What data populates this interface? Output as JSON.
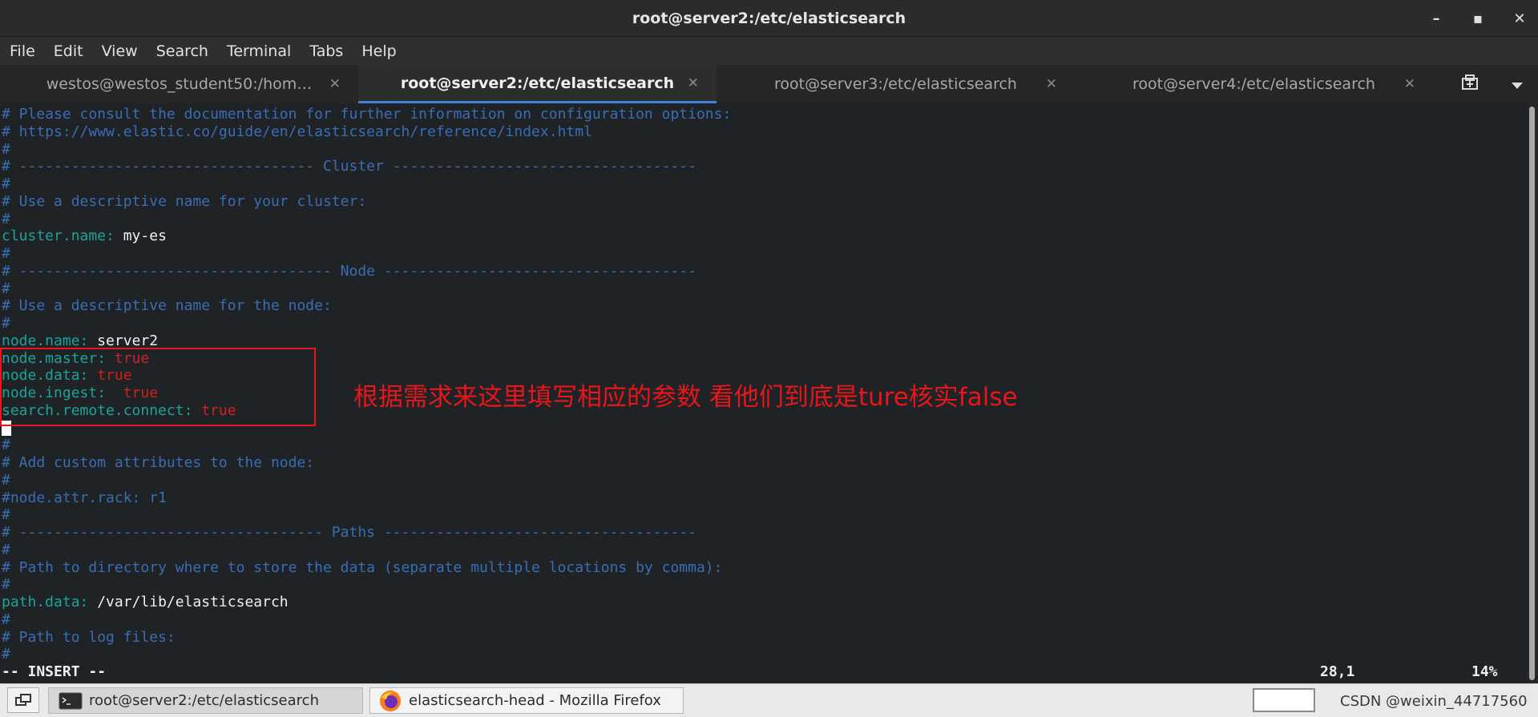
{
  "window": {
    "title": "root@server2:/etc/elasticsearch",
    "controls": [
      "–",
      "▪",
      "✕"
    ]
  },
  "menu": [
    "File",
    "Edit",
    "View",
    "Search",
    "Terminal",
    "Tabs",
    "Help"
  ],
  "tabs": [
    {
      "label": "westos@westos_student50:/hom…",
      "active": false
    },
    {
      "label": "root@server2:/etc/elasticsearch",
      "active": true
    },
    {
      "label": "root@server3:/etc/elasticsearch",
      "active": false
    },
    {
      "label": "root@server4:/etc/elasticsearch",
      "active": false
    }
  ],
  "tab_close_glyph": "✕",
  "tab_tools": {
    "new_tab_icon": "new-tab-icon",
    "menu_icon": "chevron-down-icon"
  },
  "terminal": {
    "lines": [
      {
        "parts": [
          {
            "t": "# Please consult the documentation for further information on configuration options:",
            "c": "comment"
          }
        ]
      },
      {
        "parts": [
          {
            "t": "# https://www.elastic.co/guide/en/elasticsearch/reference/index.html",
            "c": "comment"
          }
        ]
      },
      {
        "parts": [
          {
            "t": "#",
            "c": "comment"
          }
        ]
      },
      {
        "parts": [
          {
            "t": "# ---------------------------------- Cluster -----------------------------------",
            "c": "comment"
          }
        ]
      },
      {
        "parts": [
          {
            "t": "#",
            "c": "comment"
          }
        ]
      },
      {
        "parts": [
          {
            "t": "# Use a descriptive name for your cluster:",
            "c": "comment"
          }
        ]
      },
      {
        "parts": [
          {
            "t": "#",
            "c": "comment"
          }
        ]
      },
      {
        "parts": [
          {
            "t": "cluster.name: ",
            "c": "key"
          },
          {
            "t": "my-es",
            "c": "val"
          }
        ]
      },
      {
        "parts": [
          {
            "t": "#",
            "c": "comment"
          }
        ]
      },
      {
        "parts": [
          {
            "t": "# ------------------------------------ Node ------------------------------------",
            "c": "comment"
          }
        ]
      },
      {
        "parts": [
          {
            "t": "#",
            "c": "comment"
          }
        ]
      },
      {
        "parts": [
          {
            "t": "# Use a descriptive name for the node:",
            "c": "comment"
          }
        ]
      },
      {
        "parts": [
          {
            "t": "#",
            "c": "comment"
          }
        ]
      },
      {
        "parts": [
          {
            "t": "node.name: ",
            "c": "key"
          },
          {
            "t": "server2",
            "c": "val"
          }
        ]
      },
      {
        "parts": [
          {
            "t": "node.master: ",
            "c": "key"
          },
          {
            "t": "true",
            "c": "true"
          }
        ]
      },
      {
        "parts": [
          {
            "t": "node.data: ",
            "c": "key"
          },
          {
            "t": "true",
            "c": "true"
          }
        ]
      },
      {
        "parts": [
          {
            "t": "node.ingest:  ",
            "c": "key"
          },
          {
            "t": "true",
            "c": "true"
          }
        ]
      },
      {
        "parts": [
          {
            "t": "search.remote.connect: ",
            "c": "key"
          },
          {
            "t": "true",
            "c": "true"
          }
        ]
      },
      {
        "parts": [
          {
            "t": "",
            "c": "cursor"
          }
        ]
      },
      {
        "parts": [
          {
            "t": "#",
            "c": "comment"
          }
        ]
      },
      {
        "parts": [
          {
            "t": "# Add custom attributes to the node:",
            "c": "comment"
          }
        ]
      },
      {
        "parts": [
          {
            "t": "#",
            "c": "comment"
          }
        ]
      },
      {
        "parts": [
          {
            "t": "#node.attr.rack: r1",
            "c": "comment"
          }
        ]
      },
      {
        "parts": [
          {
            "t": "#",
            "c": "comment"
          }
        ]
      },
      {
        "parts": [
          {
            "t": "# ----------------------------------- Paths ------------------------------------",
            "c": "comment"
          }
        ]
      },
      {
        "parts": [
          {
            "t": "#",
            "c": "comment"
          }
        ]
      },
      {
        "parts": [
          {
            "t": "# Path to directory where to store the data (separate multiple locations by comma):",
            "c": "comment"
          }
        ]
      },
      {
        "parts": [
          {
            "t": "#",
            "c": "comment"
          }
        ]
      },
      {
        "parts": [
          {
            "t": "path.data: ",
            "c": "key"
          },
          {
            "t": "/var/lib/elasticsearch",
            "c": "val"
          }
        ]
      },
      {
        "parts": [
          {
            "t": "#",
            "c": "comment"
          }
        ]
      },
      {
        "parts": [
          {
            "t": "# Path to log files:",
            "c": "comment"
          }
        ]
      },
      {
        "parts": [
          {
            "t": "#",
            "c": "comment"
          }
        ]
      }
    ],
    "status_mode": "-- INSERT --",
    "status_position": "28,1",
    "status_percent": "14%"
  },
  "annotation": {
    "text": "根据需求来这里填写相应的参数 看他们到底是ture核实false",
    "color": "#e8151a"
  },
  "taskbar": {
    "tasks": [
      {
        "label": "root@server2:/etc/elasticsearch",
        "icon": "terminal-icon",
        "active": true
      },
      {
        "label": "elasticsearch-head - Mozilla Firefox",
        "icon": "firefox-icon",
        "active": false
      }
    ],
    "watermark": "CSDN @weixin_44717560"
  },
  "colors": {
    "comment": "#3a6db3",
    "key": "#19a39a",
    "value": "#f0f0f0",
    "true": "#d2201f",
    "accent_tab": "#3d84e0"
  }
}
